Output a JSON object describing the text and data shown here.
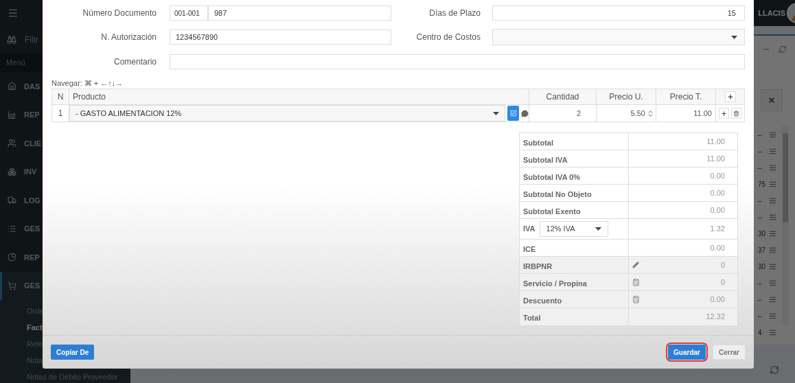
{
  "header": {
    "user": "LLACIS"
  },
  "sidebar": {
    "filter": "Filtr",
    "menu_label": "Menú",
    "items": [
      {
        "label": "DAS",
        "selected": false
      },
      {
        "label": "REP",
        "selected": false
      },
      {
        "label": "CLIE",
        "selected": false
      },
      {
        "label": "INV",
        "selected": false
      },
      {
        "label": "LOG",
        "selected": false
      },
      {
        "label": "GES",
        "selected": false
      },
      {
        "label": "REP",
        "selected": false
      },
      {
        "label": "GES",
        "selected": true
      }
    ],
    "subitems": [
      {
        "label": "Orde",
        "selected": false
      },
      {
        "label": "Fact",
        "selected": true
      },
      {
        "label": "Rete",
        "selected": false
      },
      {
        "label": "Nota",
        "selected": false
      },
      {
        "label": "Notas de Débito Proveedor",
        "selected": false
      }
    ]
  },
  "background_list": {
    "rows": [
      "–",
      "–",
      "–",
      "75",
      "–",
      "–",
      "30",
      "37",
      "30",
      "–",
      "–",
      "–",
      "4"
    ]
  },
  "modal": {
    "form": {
      "document_number": {
        "label": "Número Documento",
        "series": "001-001",
        "number": "987"
      },
      "authorization": {
        "label": "N. Autorización",
        "value": "1234567890"
      },
      "comment": {
        "label": "Comentario"
      },
      "days": {
        "label": "Días de Plazo",
        "value": "15"
      },
      "cost_center": {
        "label": "Centro de Costos"
      }
    },
    "navigation_hint": "Navegar: ⌘ + ←↑↓→",
    "table": {
      "columns": [
        "N",
        "Producto",
        "Cantidad",
        "Precio U.",
        "Precio T."
      ],
      "rows": [
        {
          "n": "1",
          "product": "- GASTO ALIMENTACION 12%",
          "quantity": "2",
          "unit_price": "5.50",
          "total_price": "11.00"
        }
      ]
    },
    "totals": [
      {
        "kind": "plain",
        "label": "Subtotal",
        "value": "11.00"
      },
      {
        "kind": "plain",
        "label": "Subtotal IVA",
        "value": "11.00"
      },
      {
        "kind": "plain",
        "label": "Subtotal IVA 0%",
        "value": "0.00"
      },
      {
        "kind": "plain",
        "label": "Subtotal No Objeto",
        "value": "0.00"
      },
      {
        "kind": "plain",
        "label": "Subtotal Exento",
        "value": "0.00"
      },
      {
        "kind": "select",
        "label": "IVA",
        "option": "12% IVA",
        "value": "1.32"
      },
      {
        "kind": "plain",
        "label": "ICE",
        "value": "0.00"
      },
      {
        "kind": "edit",
        "label": "IRBPNR",
        "value": "0"
      },
      {
        "kind": "calc",
        "label": "Servicio / Propina",
        "value": "0"
      },
      {
        "kind": "calc",
        "label": "Descuento",
        "value": "0.00"
      },
      {
        "kind": "plain",
        "label": "Total",
        "value": "12.32"
      }
    ],
    "buttons": [
      {
        "label": "Copiar De",
        "kind": "primary",
        "highlighted": false
      },
      {
        "label": "Guardar",
        "kind": "primary",
        "highlighted": true
      },
      {
        "label": "Cerrar",
        "kind": "default",
        "highlighted": false
      }
    ]
  }
}
